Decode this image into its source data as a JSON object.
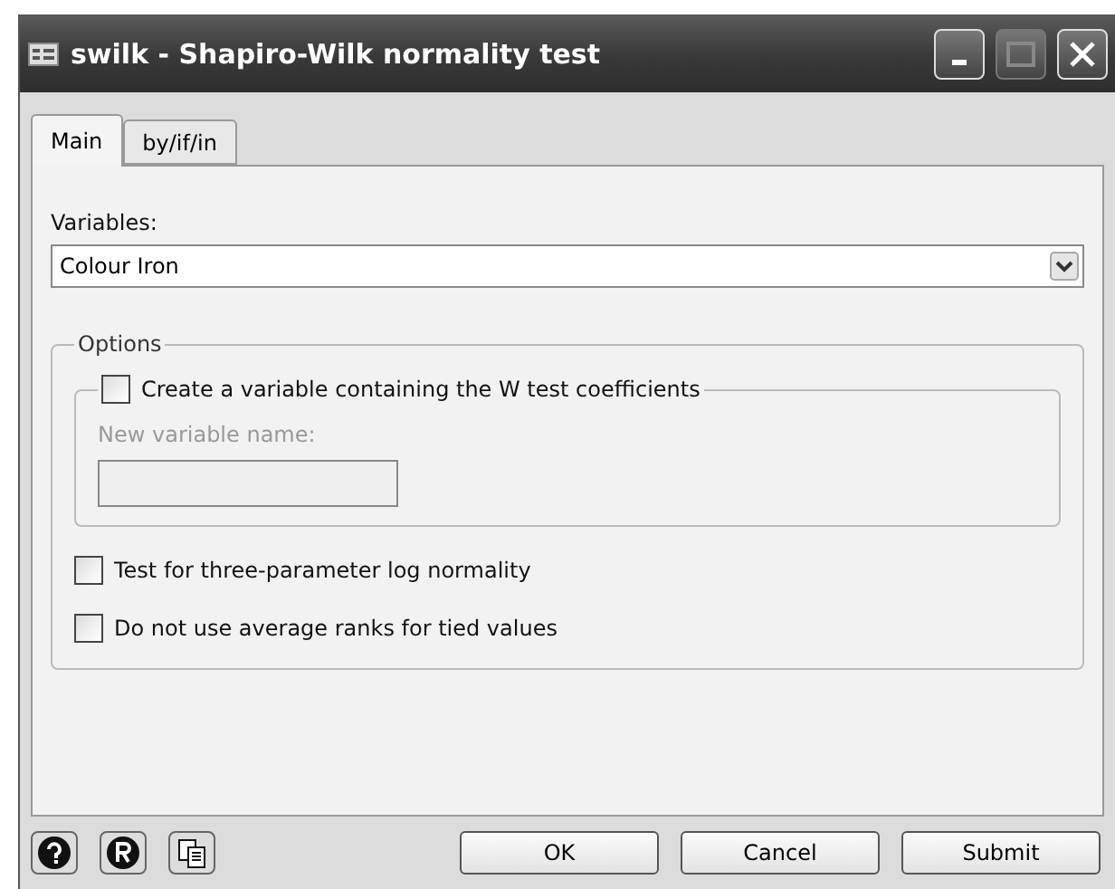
{
  "window": {
    "title": "swilk - Shapiro-Wilk normality test",
    "maximize_disabled": true
  },
  "tabs": [
    {
      "label": "Main",
      "selected": true
    },
    {
      "label": "by/if/in",
      "selected": false
    }
  ],
  "variables": {
    "label": "Variables:",
    "value": "Colour Iron"
  },
  "options": {
    "title": "Options",
    "coef_group": {
      "label": "Create a variable containing the W test coefficients",
      "checked": false,
      "field_label": "New variable name:",
      "field_disabled": true
    },
    "checkboxes": [
      {
        "label": "Test for three-parameter log normality",
        "checked": false
      },
      {
        "label": "Do not use average ranks for tied values",
        "checked": false
      }
    ]
  },
  "buttons": [
    "OK",
    "Cancel",
    "Submit"
  ]
}
